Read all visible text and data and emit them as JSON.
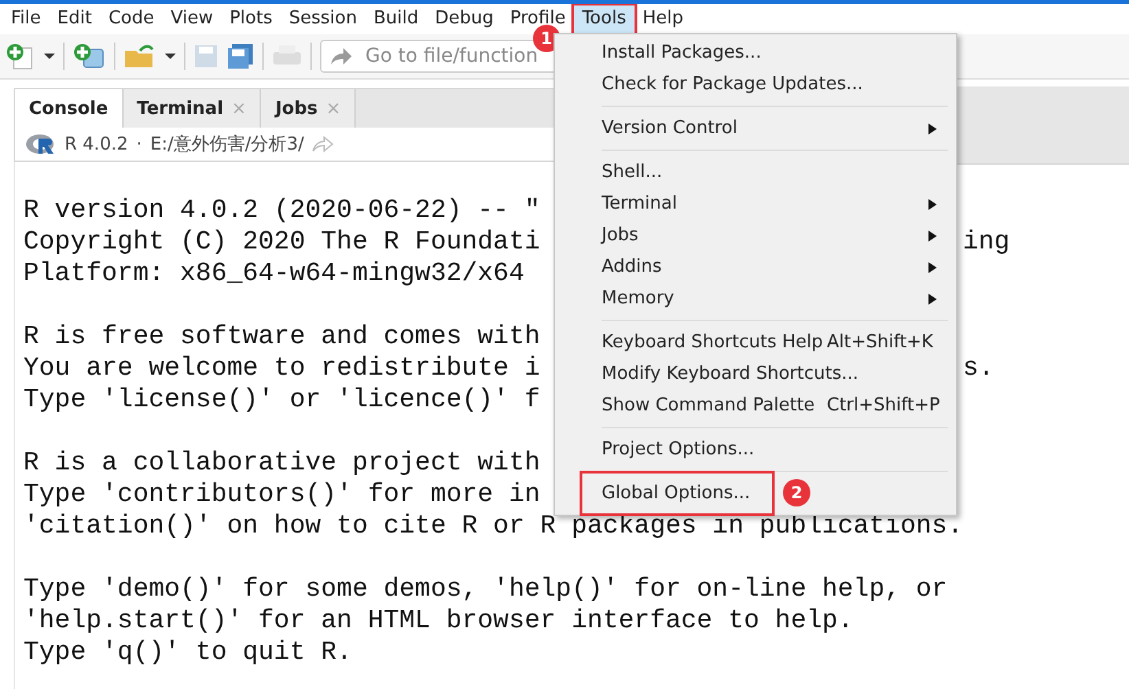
{
  "menu_bar": [
    {
      "label": "File",
      "selected": false
    },
    {
      "label": "Edit",
      "selected": false
    },
    {
      "label": "Code",
      "selected": false
    },
    {
      "label": "View",
      "selected": false
    },
    {
      "label": "Plots",
      "selected": false
    },
    {
      "label": "Session",
      "selected": false
    },
    {
      "label": "Build",
      "selected": false
    },
    {
      "label": "Debug",
      "selected": false
    },
    {
      "label": "Profile",
      "selected": false
    },
    {
      "label": "Tools",
      "selected": true,
      "callout": "1"
    },
    {
      "label": "Help",
      "selected": false
    }
  ],
  "toolbar": {
    "goto_field": {
      "placeholder": "Go to file/function"
    }
  },
  "tabs": [
    {
      "label": "Console",
      "selected": true
    },
    {
      "label": "Terminal",
      "selected": false,
      "close": "×"
    },
    {
      "label": "Jobs",
      "selected": false,
      "close": "×"
    }
  ],
  "path_bar": {
    "version": "R 4.0.2",
    "separator": "·",
    "path": "E:/意外伤害/分析3/"
  },
  "console_lines": [
    {
      "kind": "text",
      "text": "R version 4.0.2 (2020-06-22) -- \""
    },
    {
      "kind": "text",
      "text": "Copyright (C) 2020 The R Foundati",
      "tail": "ing"
    },
    {
      "kind": "text",
      "text": "Platform: x86_64-w64-mingw32/x64"
    },
    {
      "kind": "blank"
    },
    {
      "kind": "text",
      "text": "R is free software and comes with"
    },
    {
      "kind": "text",
      "text": "You are welcome to redistribute i",
      "tail": "s."
    },
    {
      "kind": "text",
      "text": "Type 'license()' or 'licence()' f"
    },
    {
      "kind": "blank"
    },
    {
      "kind": "text",
      "text": "R is a collaborative project with"
    },
    {
      "kind": "text",
      "text": "Type 'contributors()' for more in"
    },
    {
      "kind": "text",
      "text": "'citation()' on how to cite R or R packages in publications."
    },
    {
      "kind": "blank"
    },
    {
      "kind": "text",
      "text": "Type 'demo()' for some demos, 'help()' for on-line help, or"
    },
    {
      "kind": "text",
      "text": "'help.start()' for an HTML browser interface to help."
    },
    {
      "kind": "text",
      "text": "Type 'q()' to quit R."
    }
  ],
  "tools_menu": [
    {
      "kind": "item",
      "label": "Install Packages..."
    },
    {
      "kind": "item",
      "label": "Check for Package Updates..."
    },
    {
      "kind": "separator"
    },
    {
      "kind": "submenu",
      "label": "Version Control"
    },
    {
      "kind": "separator"
    },
    {
      "kind": "item",
      "label": "Shell..."
    },
    {
      "kind": "submenu",
      "label": "Terminal"
    },
    {
      "kind": "submenu",
      "label": "Jobs"
    },
    {
      "kind": "submenu",
      "label": "Addins"
    },
    {
      "kind": "submenu",
      "label": "Memory"
    },
    {
      "kind": "separator"
    },
    {
      "kind": "item",
      "label": "Keyboard Shortcuts Help",
      "shortcut": "Alt+Shift+K"
    },
    {
      "kind": "item",
      "label": "Modify Keyboard Shortcuts..."
    },
    {
      "kind": "item",
      "label": "Show Command Palette",
      "shortcut": "Ctrl+Shift+P"
    },
    {
      "kind": "separator"
    },
    {
      "kind": "item",
      "label": "Project Options..."
    },
    {
      "kind": "separator"
    },
    {
      "kind": "item",
      "label": "Global Options...",
      "highlighted": true,
      "callout": "2"
    }
  ]
}
